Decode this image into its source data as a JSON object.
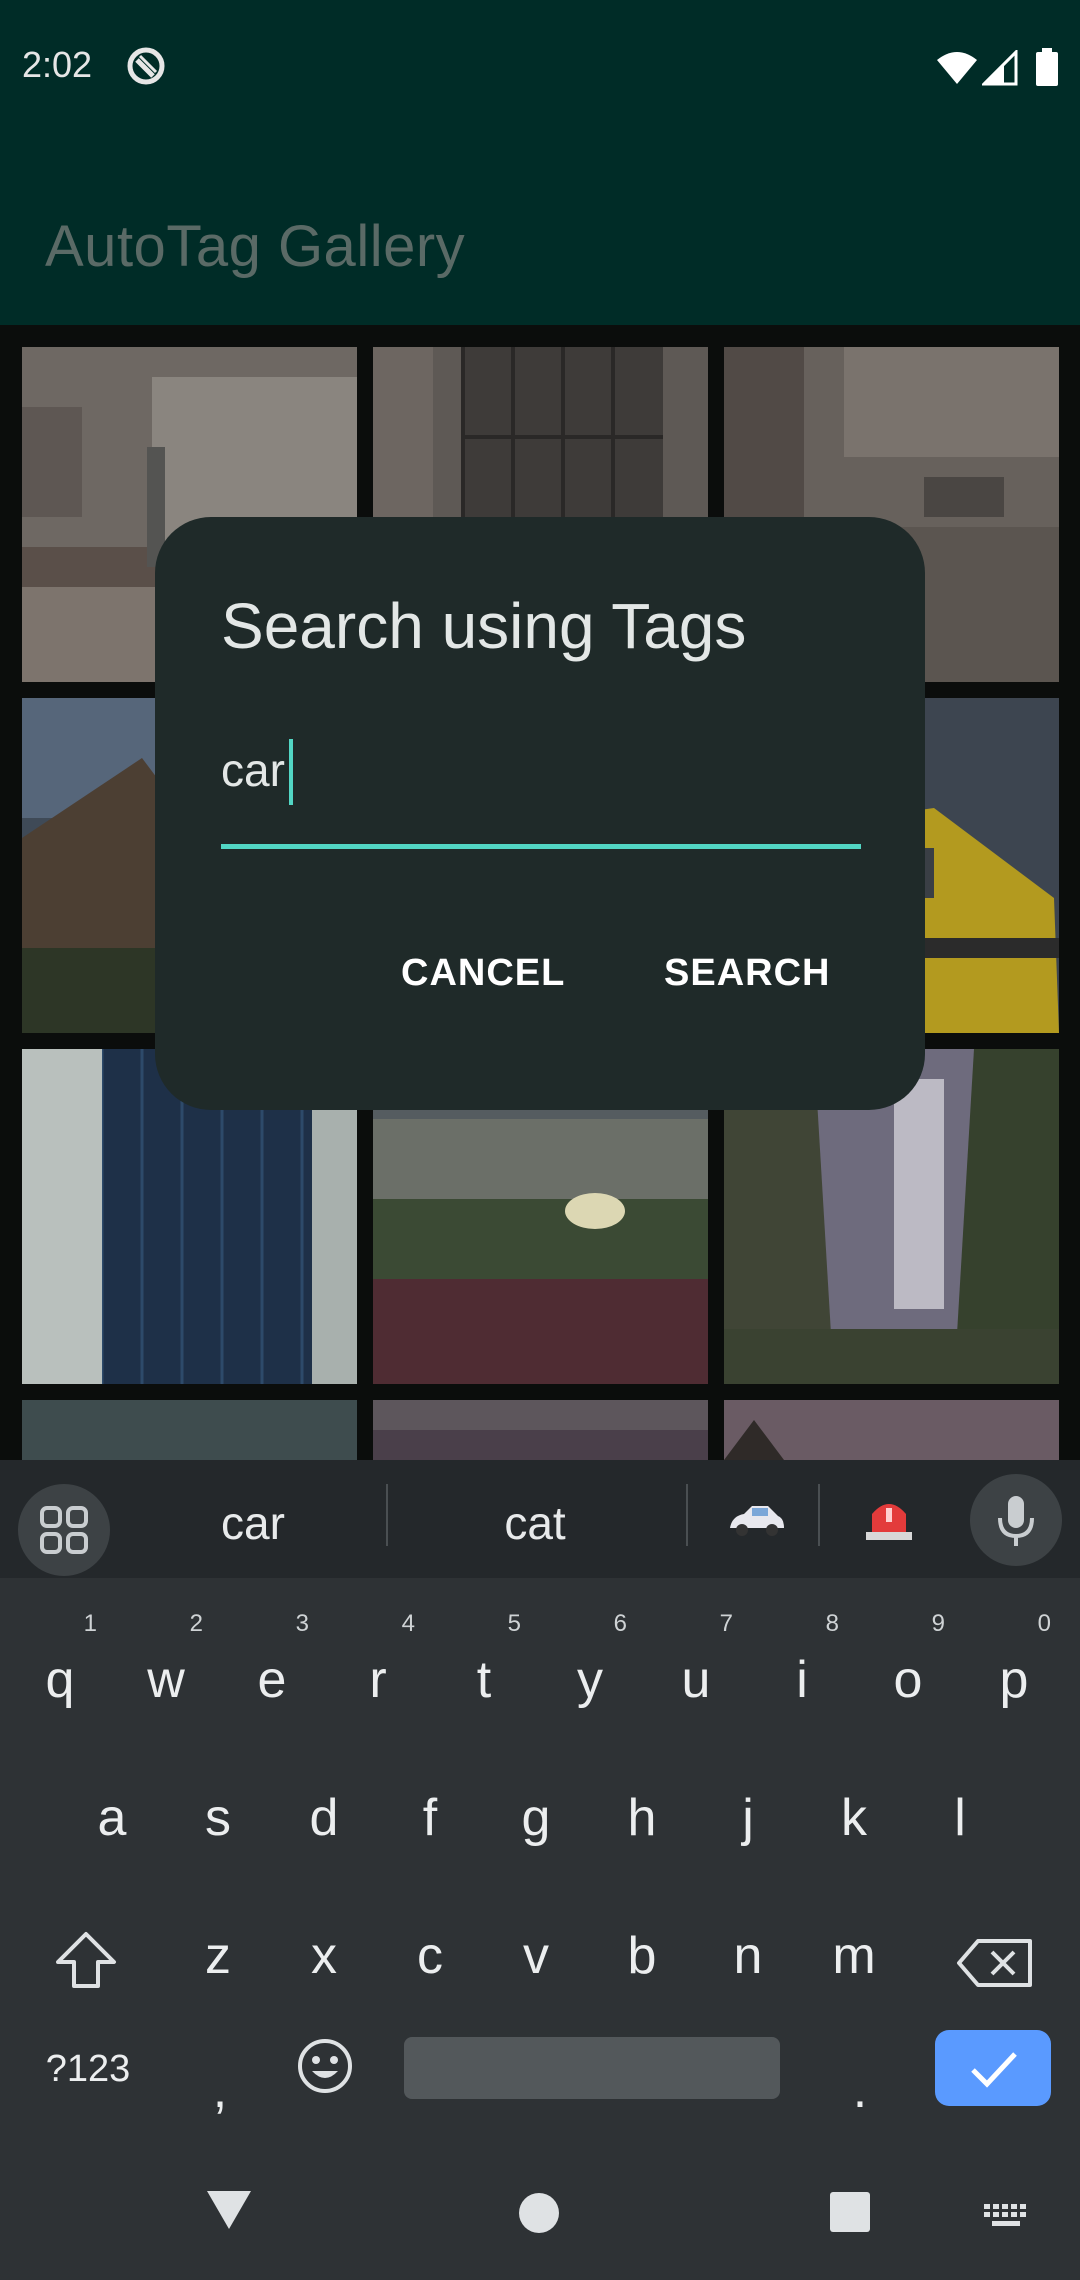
{
  "status_bar": {
    "time": "2:02"
  },
  "app_bar": {
    "title": "AutoTag Gallery"
  },
  "gallery": {
    "thumbnails": [
      "bedroom",
      "headboard-wall",
      "kitchen",
      "old-building",
      "",
      "yellow-taxi",
      "hotel-tower",
      "flower-field",
      "waterfall",
      "sky",
      "field",
      "mountain"
    ]
  },
  "dialog": {
    "title": "Search using Tags",
    "input_value": "car",
    "cancel_label": "CANCEL",
    "search_label": "SEARCH",
    "accent_color": "#52d6c4"
  },
  "keyboard": {
    "suggestions": [
      "car",
      "cat"
    ],
    "emoji_suggestions": [
      "car-emoji-icon",
      "siren-emoji-icon"
    ],
    "rows": [
      [
        [
          "q",
          "1"
        ],
        [
          "w",
          "2"
        ],
        [
          "e",
          "3"
        ],
        [
          "r",
          "4"
        ],
        [
          "t",
          "5"
        ],
        [
          "y",
          "6"
        ],
        [
          "u",
          "7"
        ],
        [
          "i",
          "8"
        ],
        [
          "o",
          "9"
        ],
        [
          "p",
          "0"
        ]
      ],
      [
        [
          "a",
          ""
        ],
        [
          "s",
          ""
        ],
        [
          "d",
          ""
        ],
        [
          "f",
          ""
        ],
        [
          "g",
          ""
        ],
        [
          "h",
          ""
        ],
        [
          "j",
          ""
        ],
        [
          "k",
          ""
        ],
        [
          "l",
          ""
        ]
      ],
      [
        [
          "z",
          ""
        ],
        [
          "x",
          ""
        ],
        [
          "c",
          ""
        ],
        [
          "v",
          ""
        ],
        [
          "b",
          ""
        ],
        [
          "n",
          ""
        ],
        [
          "m",
          ""
        ]
      ]
    ],
    "symbols_label": "?123",
    "comma_label": ",",
    "period_label": ".",
    "enter_color": "#5a9aff"
  }
}
